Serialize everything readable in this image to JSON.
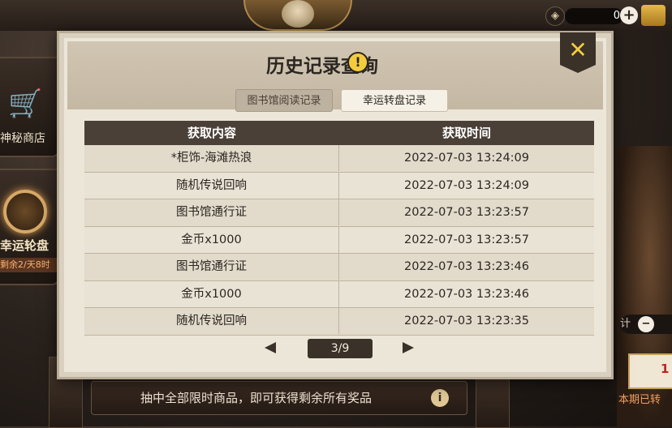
{
  "currency": {
    "amount": "0",
    "plus_label": "+"
  },
  "left_menu": {
    "shop_label": "神秘商店",
    "wheel_label": "幸运轮盘",
    "wheel_sub": "剩余2/天8时"
  },
  "dialog": {
    "title": "历史记录查询",
    "info_glyph": "!",
    "close_glyph": "✕",
    "tabs": [
      {
        "label": "图书馆阅读记录",
        "selected": true
      },
      {
        "label": "幸运转盘记录",
        "selected": false
      }
    ],
    "table": {
      "headers": [
        "获取内容",
        "获取时间"
      ],
      "rows": [
        {
          "content": "*柜饰-海滩热浪",
          "time": "2022-07-03 13:24:09"
        },
        {
          "content": "随机传说回响",
          "time": "2022-07-03 13:24:09"
        },
        {
          "content": "图书馆通行证",
          "time": "2022-07-03 13:23:57"
        },
        {
          "content": "金币x1000",
          "time": "2022-07-03 13:23:57"
        },
        {
          "content": "图书馆通行证",
          "time": "2022-07-03 13:23:46"
        },
        {
          "content": "金币x1000",
          "time": "2022-07-03 13:23:46"
        },
        {
          "content": "随机传说回响",
          "time": "2022-07-03 13:23:35"
        }
      ]
    },
    "pager": {
      "label": "3/9"
    }
  },
  "bottom_banner": {
    "text": "抽中全部限时商品，即可获得剩余所有奖品",
    "info_glyph": "i"
  },
  "right_side": {
    "pill_label": "计",
    "minus_glyph": "−",
    "card_count": "1",
    "caption": "本期已转"
  },
  "colors": {
    "accent_yellow": "#f3cc3e",
    "panel_bg": "#ece6d9",
    "header_bg": "#4b4037"
  }
}
